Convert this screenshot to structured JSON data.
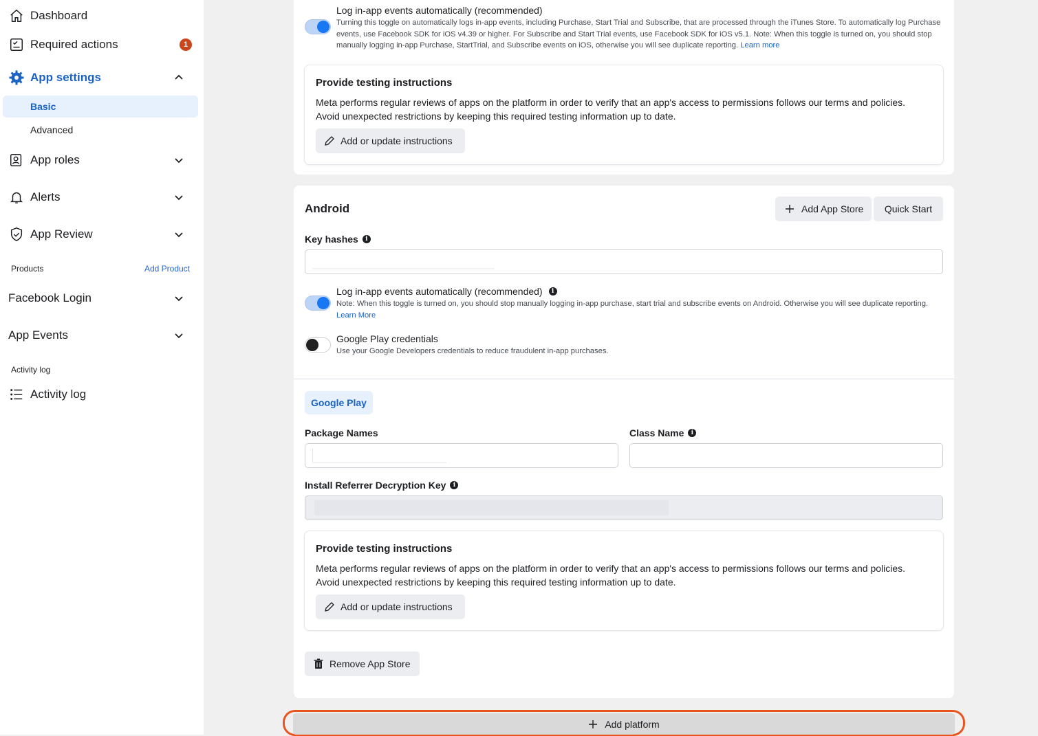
{
  "sidebar": {
    "dashboard": "Dashboard",
    "required_actions": "Required actions",
    "required_actions_count": "1",
    "app_settings": "App settings",
    "basic": "Basic",
    "advanced": "Advanced",
    "app_roles": "App roles",
    "alerts": "Alerts",
    "app_review": "App Review",
    "products_heading": "Products",
    "add_product": "Add Product",
    "facebook_login": "Facebook Login",
    "app_events": "App Events",
    "activity_heading": "Activity log",
    "activity_log": "Activity log"
  },
  "ios": {
    "log_events_title": "Log in-app events automatically (recommended)",
    "log_events_desc": "Turning this toggle on automatically logs in-app events, including Purchase, Start Trial and Subscribe, that are processed through the iTunes Store. To automatically log Purchase events, use Facebook SDK for iOS v4.39 or higher. For Subscribe and Start Trial events, use Facebook SDK for iOS v5.1. Note: When this toggle is turned on, you should stop manually logging in-app Purchase, StartTrial, and Subscribe events on iOS, otherwise you will see duplicate reporting.",
    "learn_more": "Learn more",
    "testing_title": "Provide testing instructions",
    "testing_desc_1": "Meta performs regular reviews of apps on the platform in order to verify that an app's access to permissions follows our terms and policies.",
    "testing_desc_2": "Avoid unexpected restrictions by keeping this required testing information up to date.",
    "testing_button": "Add or update instructions"
  },
  "android": {
    "title": "Android",
    "add_app_store": "Add App Store",
    "quick_start": "Quick Start",
    "key_hashes_label": "Key hashes",
    "log_events_title": "Log in-app events automatically (recommended)",
    "log_events_desc": "Note: When this toggle is turned on, you should stop manually logging in-app purchase, start trial and subscribe events on Android. Otherwise you will see duplicate reporting.",
    "learn_more": "Learn More",
    "gplay_cred_title": "Google Play credentials",
    "gplay_cred_desc": "Use your Google Developers credentials to reduce fraudulent in-app purchases.",
    "google_play_tab": "Google Play",
    "package_names_label": "Package Names",
    "class_name_label": "Class Name",
    "referrer_key_label": "Install Referrer Decryption Key",
    "testing_title": "Provide testing instructions",
    "testing_desc_1": "Meta performs regular reviews of apps on the platform in order to verify that an app's access to permissions follows our terms and policies.",
    "testing_desc_2": "Avoid unexpected restrictions by keeping this required testing information up to date.",
    "testing_button": "Add or update instructions",
    "remove_app_store": "Remove App Store"
  },
  "add_platform": "Add platform",
  "colors": {
    "accent": "#1877f2",
    "link": "#1a62c4",
    "badge": "#c9461c",
    "highlight_ring": "#e8541e"
  }
}
